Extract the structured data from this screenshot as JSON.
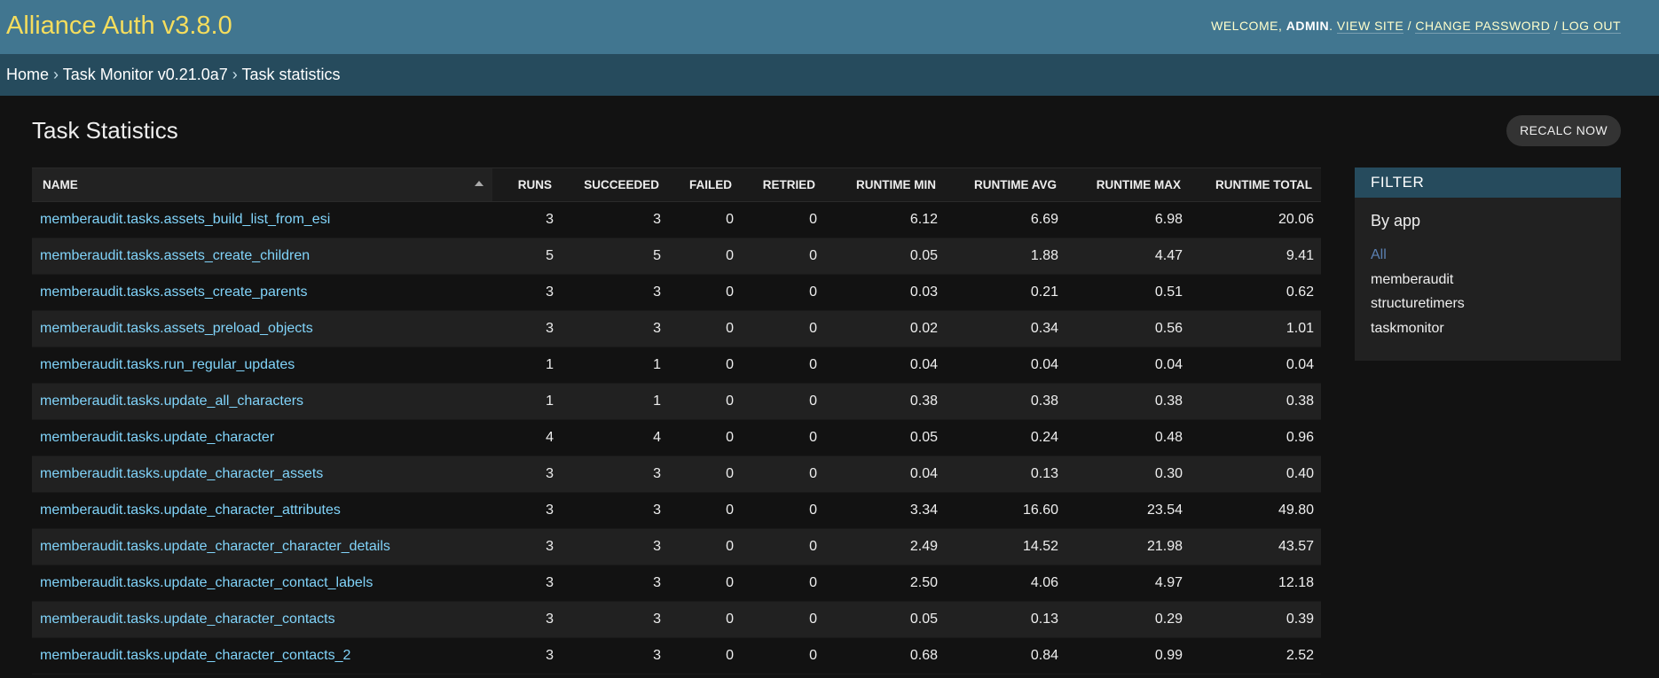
{
  "header": {
    "site_title": "Alliance Auth v3.8.0",
    "welcome_text": "WELCOME, ",
    "username": "ADMIN",
    "after_username": ". ",
    "view_site": "VIEW SITE",
    "separator": " / ",
    "change_password": "CHANGE PASSWORD",
    "log_out": "LOG OUT"
  },
  "breadcrumbs": {
    "home": "Home",
    "separator": " › ",
    "app": "Task Monitor v0.21.0a7",
    "current": "Task statistics"
  },
  "page": {
    "title": "Task Statistics",
    "recalc_button": "RECALC NOW"
  },
  "table": {
    "columns": [
      "NAME",
      "RUNS",
      "SUCCEEDED",
      "FAILED",
      "RETRIED",
      "RUNTIME MIN",
      "RUNTIME AVG",
      "RUNTIME MAX",
      "RUNTIME TOTAL"
    ],
    "rows": [
      {
        "name": "memberaudit.tasks.assets_build_list_from_esi",
        "runs": "3",
        "succeeded": "3",
        "failed": "0",
        "retried": "0",
        "min": "6.12",
        "avg": "6.69",
        "max": "6.98",
        "total": "20.06"
      },
      {
        "name": "memberaudit.tasks.assets_create_children",
        "runs": "5",
        "succeeded": "5",
        "failed": "0",
        "retried": "0",
        "min": "0.05",
        "avg": "1.88",
        "max": "4.47",
        "total": "9.41"
      },
      {
        "name": "memberaudit.tasks.assets_create_parents",
        "runs": "3",
        "succeeded": "3",
        "failed": "0",
        "retried": "0",
        "min": "0.03",
        "avg": "0.21",
        "max": "0.51",
        "total": "0.62"
      },
      {
        "name": "memberaudit.tasks.assets_preload_objects",
        "runs": "3",
        "succeeded": "3",
        "failed": "0",
        "retried": "0",
        "min": "0.02",
        "avg": "0.34",
        "max": "0.56",
        "total": "1.01"
      },
      {
        "name": "memberaudit.tasks.run_regular_updates",
        "runs": "1",
        "succeeded": "1",
        "failed": "0",
        "retried": "0",
        "min": "0.04",
        "avg": "0.04",
        "max": "0.04",
        "total": "0.04"
      },
      {
        "name": "memberaudit.tasks.update_all_characters",
        "runs": "1",
        "succeeded": "1",
        "failed": "0",
        "retried": "0",
        "min": "0.38",
        "avg": "0.38",
        "max": "0.38",
        "total": "0.38"
      },
      {
        "name": "memberaudit.tasks.update_character",
        "runs": "4",
        "succeeded": "4",
        "failed": "0",
        "retried": "0",
        "min": "0.05",
        "avg": "0.24",
        "max": "0.48",
        "total": "0.96"
      },
      {
        "name": "memberaudit.tasks.update_character_assets",
        "runs": "3",
        "succeeded": "3",
        "failed": "0",
        "retried": "0",
        "min": "0.04",
        "avg": "0.13",
        "max": "0.30",
        "total": "0.40"
      },
      {
        "name": "memberaudit.tasks.update_character_attributes",
        "runs": "3",
        "succeeded": "3",
        "failed": "0",
        "retried": "0",
        "min": "3.34",
        "avg": "16.60",
        "max": "23.54",
        "total": "49.80"
      },
      {
        "name": "memberaudit.tasks.update_character_character_details",
        "runs": "3",
        "succeeded": "3",
        "failed": "0",
        "retried": "0",
        "min": "2.49",
        "avg": "14.52",
        "max": "21.98",
        "total": "43.57"
      },
      {
        "name": "memberaudit.tasks.update_character_contact_labels",
        "runs": "3",
        "succeeded": "3",
        "failed": "0",
        "retried": "0",
        "min": "2.50",
        "avg": "4.06",
        "max": "4.97",
        "total": "12.18"
      },
      {
        "name": "memberaudit.tasks.update_character_contacts",
        "runs": "3",
        "succeeded": "3",
        "failed": "0",
        "retried": "0",
        "min": "0.05",
        "avg": "0.13",
        "max": "0.29",
        "total": "0.39"
      },
      {
        "name": "memberaudit.tasks.update_character_contacts_2",
        "runs": "3",
        "succeeded": "3",
        "failed": "0",
        "retried": "0",
        "min": "0.68",
        "avg": "0.84",
        "max": "0.99",
        "total": "2.52"
      }
    ]
  },
  "filter": {
    "title": "FILTER",
    "heading": "By app",
    "options": [
      "All",
      "memberaudit",
      "structuretimers",
      "taskmonitor"
    ],
    "selected": "All"
  },
  "icons": {
    "sort": "sort-ascending-icon"
  },
  "colors": {
    "header_bg": "#417690",
    "breadcrumb_bg": "#264b5d",
    "branding": "#f5dd5d",
    "link": "#81d4fa",
    "selected_filter": "#5b80b2"
  }
}
